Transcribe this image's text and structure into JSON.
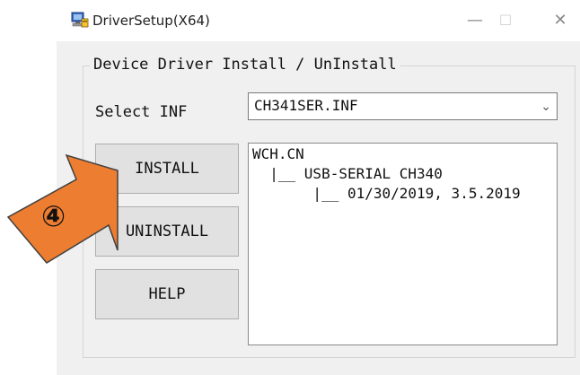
{
  "window": {
    "title": "DriverSetup(X64)",
    "controls": {
      "minimize": "—",
      "maximize": "☐",
      "close": "✕"
    }
  },
  "group": {
    "label": "Device Driver Install / UnInstall"
  },
  "inf": {
    "label": "Select INF",
    "selected": "CH341SER.INF",
    "arrow": "⌄"
  },
  "buttons": {
    "install": "INSTALL",
    "uninstall": "UNINSTALL",
    "help": "HELP"
  },
  "info": {
    "lines": [
      "WCH.CN",
      "  |__ USB-SERIAL CH340",
      "       |__ 01/30/2019, 3.5.2019"
    ]
  },
  "callout": {
    "step": "④",
    "color": "#ed7d31",
    "outline": "#404040"
  },
  "colors": {
    "window_bg": "#f0f0f0",
    "button_bg": "#e1e1e1"
  }
}
